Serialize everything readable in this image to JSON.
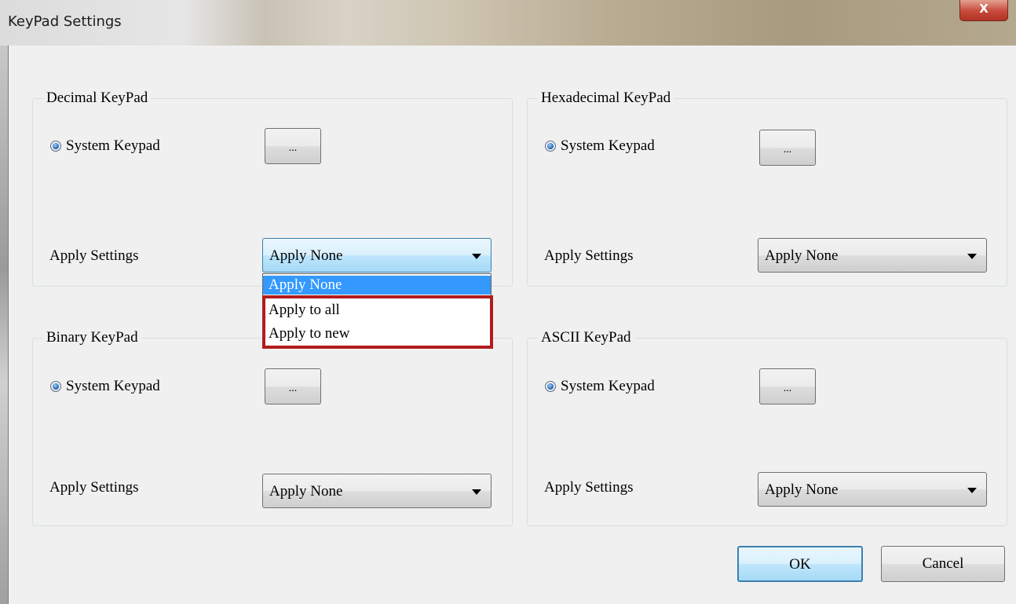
{
  "window": {
    "title": "KeyPad Settings",
    "close_glyph": "X"
  },
  "groups": {
    "decimal": {
      "title": "Decimal KeyPad",
      "radio_label": "System Keypad",
      "dots": "...",
      "apply_label": "Apply Settings",
      "combo_value": "Apply None"
    },
    "hexadecimal": {
      "title": "Hexadecimal KeyPad",
      "radio_label": "System Keypad",
      "dots": "...",
      "apply_label": "Apply Settings",
      "combo_value": "Apply None"
    },
    "binary": {
      "title": "Binary KeyPad",
      "radio_label": "System Keypad",
      "dots": "...",
      "apply_label": "Apply Settings",
      "combo_value": "Apply None"
    },
    "ascii": {
      "title": "ASCII KeyPad",
      "radio_label": "System Keypad",
      "dots": "...",
      "apply_label": "Apply Settings",
      "combo_value": "Apply None"
    }
  },
  "dropdown": {
    "items": [
      "Apply None",
      "Apply to all",
      "Apply to new"
    ],
    "selected_index": 0
  },
  "buttons": {
    "ok": "OK",
    "cancel": "Cancel"
  },
  "colors": {
    "highlight_box": "#b01c1c",
    "selection": "#3399ff"
  }
}
